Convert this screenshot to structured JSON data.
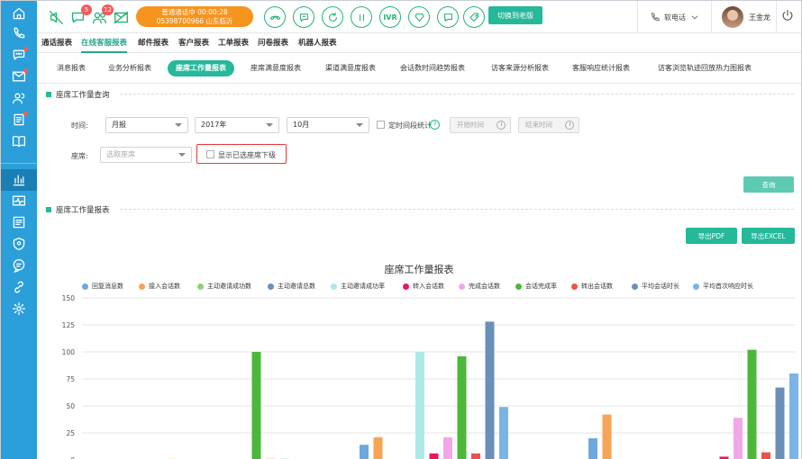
{
  "sidebar": {
    "items": [
      {
        "name": "home-icon",
        "dot": false
      },
      {
        "name": "phone-icon",
        "dot": false
      },
      {
        "name": "chat-bubble-icon",
        "dot": true
      },
      {
        "name": "mail-icon",
        "dot": true
      },
      {
        "name": "contacts-icon",
        "dot": false
      },
      {
        "name": "ticket-list-icon",
        "dot": true
      },
      {
        "name": "book-icon",
        "dot": false
      },
      {
        "name": "bar-chart-icon",
        "dot": false,
        "active": true
      },
      {
        "name": "pulse-icon",
        "dot": false
      },
      {
        "name": "form-icon",
        "dot": false
      },
      {
        "name": "shield-icon",
        "dot": false
      },
      {
        "name": "speech-icon",
        "dot": false
      },
      {
        "name": "link-icon",
        "dot": false
      },
      {
        "name": "settings-icon",
        "dot": false
      }
    ]
  },
  "topbar": {
    "chat_badge": "5",
    "user_badge": "12",
    "call_status_line1": "普通通话中  00:00:28",
    "call_status_line2": "05398700966 山东临沂",
    "ivr_label": "IVR",
    "switch_label": "切换到老版",
    "softphone_label": "软电话",
    "user_name": "王金龙"
  },
  "main_tabs": [
    "通话报表",
    "在线客服报表",
    "邮件报表",
    "客户报表",
    "工单报表",
    "问卷报表",
    "机器人报表"
  ],
  "main_tabs_active": 1,
  "sub_tabs": [
    "消息报表",
    "业务分析报表",
    "座席工作量报表",
    "座席满意度报表",
    "渠道满意度报表",
    "会话数时间趋势报表",
    "访客来源分析报表",
    "客服响应统计报表",
    "访客浏览轨迹回放热力图报表"
  ],
  "sub_tabs_active": 2,
  "query": {
    "section_title": "座席工作量查询",
    "time_label": "时间:",
    "period_value": "月报",
    "year_value": "2017年",
    "month_value": "10月",
    "timed_stats_label": "定时间段统计",
    "help_glyph": "?",
    "start_time_placeholder": "开始时间",
    "end_time_placeholder": "结束时间",
    "agent_label": "座席:",
    "agent_placeholder": "选取座席",
    "show_sub_label": "显示已选座席下级",
    "query_button": "查询"
  },
  "report": {
    "section_title": "座席工作量报表",
    "export_pdf": "导出PDF",
    "export_excel": "导出EXCEL"
  },
  "chart_data": {
    "type": "bar",
    "title": "座席工作量报表",
    "xlabel": "",
    "ylabel": "",
    "ylim": [
      0,
      150
    ],
    "yticks": [
      0,
      25,
      50,
      75,
      100,
      125,
      150
    ],
    "grid": true,
    "legend_position": "top",
    "groups_visible": 4,
    "series": [
      {
        "name": "回复消息数",
        "color": "#7cb5ec",
        "values": [
          0,
          0,
          0,
          0
        ]
      },
      {
        "name": "接入会话数",
        "color": "#f7a35c",
        "values": [
          1,
          0,
          0,
          0
        ]
      },
      {
        "name": "主动邀请成功数",
        "color": "#90ed7d",
        "values": [
          0,
          0,
          0,
          0
        ]
      },
      {
        "name": "主动邀请总数",
        "color": "#8085e9",
        "values": [
          0,
          0,
          0,
          0
        ]
      },
      {
        "name": "主动邀请成功率",
        "color": "#91e8e1",
        "values": [
          0,
          0,
          0,
          0
        ]
      },
      {
        "name": "转入会话数",
        "color": "#f15c80",
        "values": [
          0,
          0,
          0,
          0
        ]
      },
      {
        "name": "完成会话数",
        "color": "#e4d354",
        "values": [
          0,
          0,
          0,
          0
        ]
      },
      {
        "name": "会话完成率",
        "color": "#2b908f",
        "values": [
          0,
          0,
          0,
          0
        ]
      },
      {
        "name": "转出会话数",
        "color": "#f45b5b",
        "values": [
          0,
          0,
          0,
          0
        ]
      },
      {
        "name": "平均会话时长",
        "color": "#91e8e1",
        "values": [
          0,
          0,
          0,
          0
        ]
      },
      {
        "name": "平均首次响应时长",
        "color": "#7cb5ec",
        "values": [
          0,
          0,
          0,
          0
        ]
      }
    ],
    "bars": [
      {
        "group": 0,
        "series": "接入会话数",
        "color": "#f7a35c",
        "value": 1,
        "slot": 1
      },
      {
        "group": 0,
        "series": "会话完成率",
        "color": "#4cb83a",
        "value": 100,
        "slot": 7
      },
      {
        "group": 0,
        "series": "转出会话数",
        "color": "#e8544e",
        "value": 1,
        "slot": 8
      },
      {
        "group": 0,
        "series": "平均会话时长",
        "color": "#6b8fb8",
        "value": 1,
        "slot": 9
      },
      {
        "group": 1,
        "series": "回复消息数",
        "color": "#6fa8dc",
        "value": 14,
        "slot": 0
      },
      {
        "group": 1,
        "series": "接入会话数",
        "color": "#f6a456",
        "value": 21,
        "slot": 1
      },
      {
        "group": 1,
        "series": "主动邀请成功率",
        "color": "#aee9ea",
        "value": 100,
        "slot": 4
      },
      {
        "group": 1,
        "series": "转入会话数",
        "color": "#e8185c",
        "value": 6,
        "slot": 5
      },
      {
        "group": 1,
        "series": "完成会话数",
        "color": "#f1a7e8",
        "value": 21,
        "slot": 6
      },
      {
        "group": 1,
        "series": "会话完成率",
        "color": "#4cb83a",
        "value": 96,
        "slot": 7
      },
      {
        "group": 1,
        "series": "转出会话数",
        "color": "#e8544e",
        "value": 6,
        "slot": 8
      },
      {
        "group": 1,
        "series": "平均会话时长",
        "color": "#6b8fb8",
        "value": 128,
        "slot": 9
      },
      {
        "group": 1,
        "series": "平均首次响应时长",
        "color": "#7ab3e6",
        "value": 49,
        "slot": 10
      },
      {
        "group": 2,
        "series": "回复消息数",
        "color": "#6fa8dc",
        "value": 20,
        "slot": 0
      },
      {
        "group": 2,
        "series": "接入会话数",
        "color": "#f6a456",
        "value": 42,
        "slot": 1
      },
      {
        "group": 3,
        "series": "转入会话数",
        "color": "#e8185c",
        "value": 3,
        "slot": 5
      },
      {
        "group": 3,
        "series": "完成会话数",
        "color": "#f1a7e8",
        "value": 39,
        "slot": 6
      },
      {
        "group": 3,
        "series": "会话完成率",
        "color": "#4cb83a",
        "value": 102,
        "slot": 7
      },
      {
        "group": 3,
        "series": "转出会话数",
        "color": "#e8544e",
        "value": 7,
        "slot": 8
      },
      {
        "group": 3,
        "series": "平均会话时长",
        "color": "#6b8fb8",
        "value": 67,
        "slot": 9
      },
      {
        "group": 3,
        "series": "平均首次响应时长",
        "color": "#7ab3e6",
        "value": 80,
        "slot": 10
      }
    ],
    "legend": [
      {
        "name": "回复消息数",
        "color": "#6fa8dc"
      },
      {
        "name": "接入会话数",
        "color": "#f6a456"
      },
      {
        "name": "主动邀请成功数",
        "color": "#8fd07a"
      },
      {
        "name": "主动邀请总数",
        "color": "#6b8fb8"
      },
      {
        "name": "主动邀请成功率",
        "color": "#aee9ea"
      },
      {
        "name": "转入会话数",
        "color": "#e8185c"
      },
      {
        "name": "完成会话数",
        "color": "#f1a7e8"
      },
      {
        "name": "会话完成率",
        "color": "#4cb83a"
      },
      {
        "name": "转出会话数",
        "color": "#e8544e"
      },
      {
        "name": "平均会话时长",
        "color": "#6b8fb8"
      },
      {
        "name": "平均首次响应时长",
        "color": "#7ab3e6"
      }
    ]
  }
}
